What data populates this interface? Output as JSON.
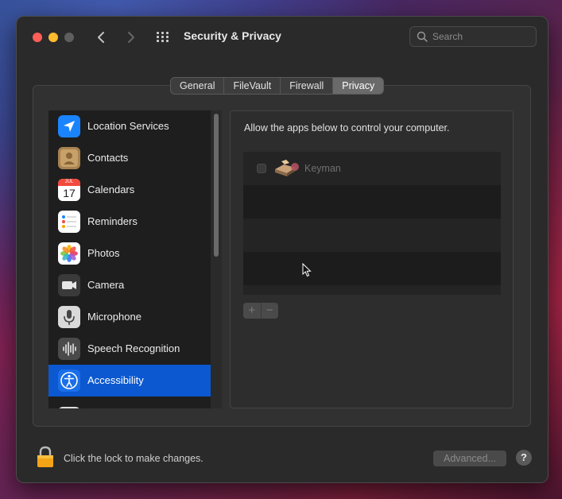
{
  "window": {
    "title": "Security & Privacy",
    "search_placeholder": "Search"
  },
  "tabs": [
    {
      "label": "General",
      "active": false
    },
    {
      "label": "FileVault",
      "active": false
    },
    {
      "label": "Firewall",
      "active": false
    },
    {
      "label": "Privacy",
      "active": true
    }
  ],
  "sidebar": {
    "items": [
      {
        "label": "Location Services",
        "icon": "location-arrow-icon"
      },
      {
        "label": "Contacts",
        "icon": "contacts-icon"
      },
      {
        "label": "Calendars",
        "icon": "calendar-icon",
        "calendar_month": "JUL",
        "calendar_day": "17"
      },
      {
        "label": "Reminders",
        "icon": "reminders-icon"
      },
      {
        "label": "Photos",
        "icon": "photos-icon"
      },
      {
        "label": "Camera",
        "icon": "camera-icon"
      },
      {
        "label": "Microphone",
        "icon": "microphone-icon"
      },
      {
        "label": "Speech Recognition",
        "icon": "waveform-icon"
      },
      {
        "label": "Accessibility",
        "icon": "accessibility-icon",
        "selected": true
      }
    ]
  },
  "privacy_pane": {
    "heading": "Allow the apps below to control your computer.",
    "apps": [
      {
        "name": "Keyman",
        "checked": false,
        "icon": "keyman-icon"
      }
    ],
    "add_label": "+",
    "remove_label": "−"
  },
  "footer": {
    "lock_text": "Click the lock to make changes.",
    "advanced_label": "Advanced...",
    "help_label": "?"
  },
  "colors": {
    "selection": "#0b58d0",
    "close": "#fe5f57",
    "minimize": "#febc2e"
  }
}
